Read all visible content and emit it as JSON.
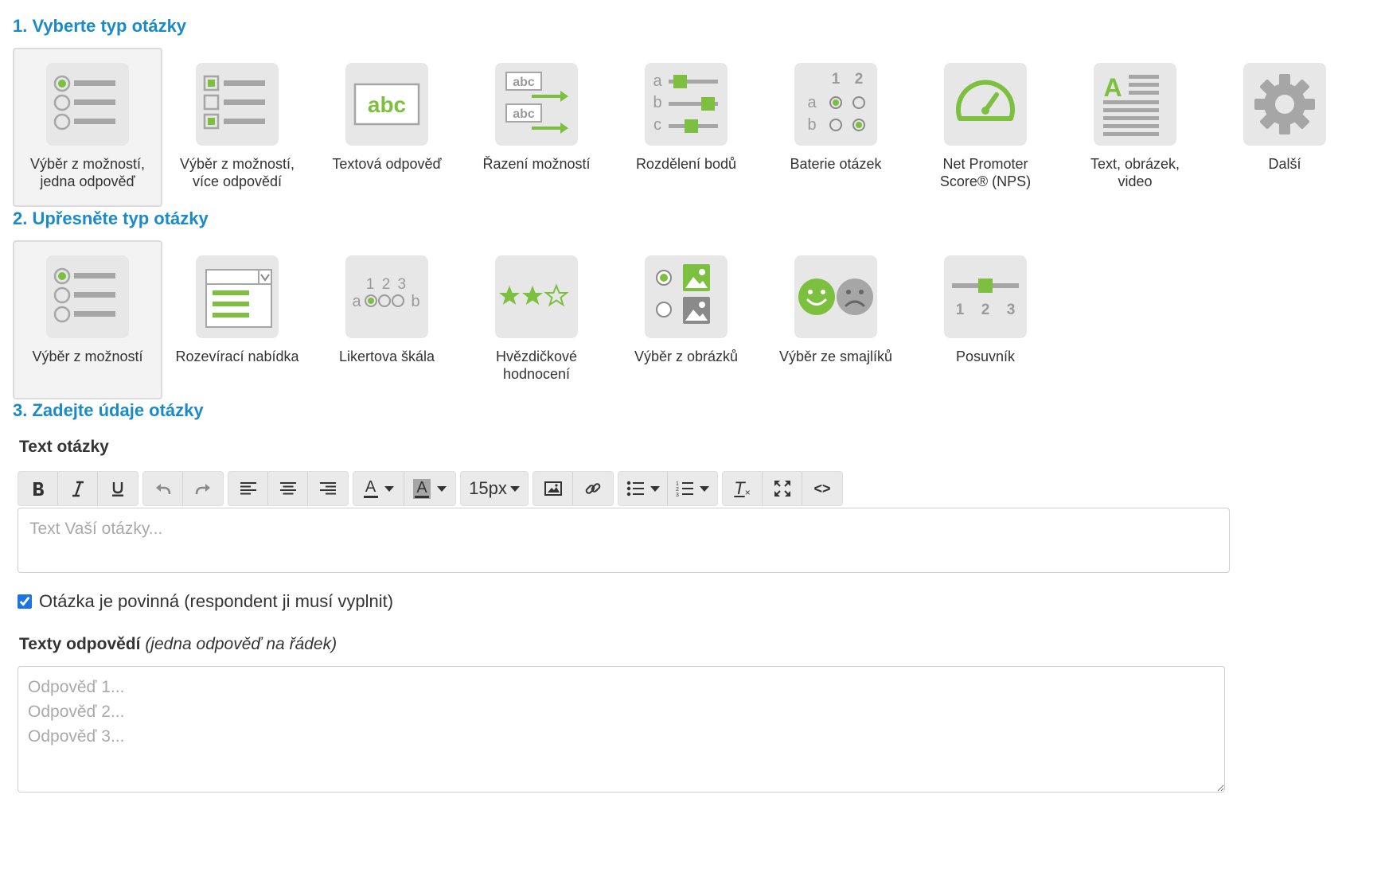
{
  "step1": {
    "heading": "1. Vyberte typ otázky",
    "tiles": [
      {
        "label": "Výběr z možností,\njedna odpověď",
        "icon": "single-choice-icon",
        "selected": true
      },
      {
        "label": "Výběr z možností,\nvíce odpovědí",
        "icon": "multiple-choice-icon",
        "selected": false
      },
      {
        "label": "Textová odpověď",
        "icon": "text-answer-icon",
        "selected": false
      },
      {
        "label": "Řazení možností",
        "icon": "ranking-icon",
        "selected": false
      },
      {
        "label": "Rozdělení bodů",
        "icon": "points-distribution-icon",
        "selected": false
      },
      {
        "label": "Baterie otázek",
        "icon": "question-battery-icon",
        "selected": false
      },
      {
        "label": "Net Promoter\nScore® (NPS)",
        "icon": "nps-gauge-icon",
        "selected": false
      },
      {
        "label": "Text, obrázek,\nvideo",
        "icon": "text-image-video-icon",
        "selected": false
      },
      {
        "label": "Další",
        "icon": "gear-icon",
        "selected": false
      }
    ],
    "icon_text": {
      "abc": "abc",
      "ranking": [
        "abc",
        "abc"
      ],
      "points_letters": [
        "a",
        "b",
        "c"
      ],
      "battery_cols": [
        "1",
        "2"
      ],
      "battery_rows": [
        "a",
        "b"
      ],
      "page_letter": "A"
    }
  },
  "step2": {
    "heading": "2. Upřesněte typ otázky",
    "tiles": [
      {
        "label": "Výběr z možností",
        "icon": "radio-list-icon",
        "selected": true
      },
      {
        "label": "Rozevírací nabídka",
        "icon": "dropdown-icon",
        "selected": false
      },
      {
        "label": "Likertova škála",
        "icon": "likert-scale-icon",
        "selected": false
      },
      {
        "label": "Hvězdičkové\nhodnocení",
        "icon": "star-rating-icon",
        "selected": false
      },
      {
        "label": "Výběr z obrázků",
        "icon": "image-choice-icon",
        "selected": false
      },
      {
        "label": "Výběr ze smajlíků",
        "icon": "smiley-choice-icon",
        "selected": false
      },
      {
        "label": "Posuvník",
        "icon": "slider-icon",
        "selected": false
      }
    ],
    "icon_text": {
      "likert_numbers": "1 2 3",
      "likert_ends": [
        "a",
        "b"
      ],
      "slider_numbers": [
        "1",
        "2",
        "3"
      ]
    }
  },
  "step3": {
    "heading": "3. Zadejte údaje otázky",
    "question_text_label": "Text otázky",
    "toolbar": {
      "font_size": "15px",
      "text_color_glyph": "A",
      "bg_color_glyph": "A",
      "clear_format_glyph": "T",
      "code_glyph": "<>"
    },
    "question_placeholder": "Text Vaší otázky...",
    "required_label": "Otázka je povinná (respondent ji musí vyplnit)",
    "required_checked": true,
    "answers_label": "Texty odpovědí",
    "answers_hint": "(jedna odpověď na řádek)",
    "answers_placeholder": "Odpověď 1...\nOdpověď 2...\nOdpověď 3..."
  },
  "colors": {
    "accent": "#1a8bc6",
    "green": "#7dc03f",
    "icon_bg": "#e7e7e7",
    "icon_gray": "#a6a6a6"
  }
}
